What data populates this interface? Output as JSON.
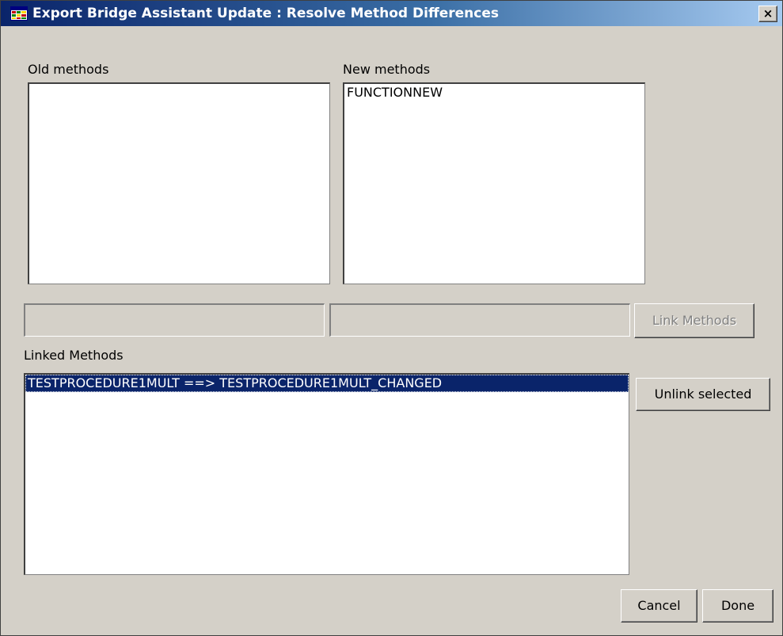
{
  "window": {
    "title": "Export Bridge Assistant Update : Resolve Method Differences",
    "close_glyph": "×"
  },
  "old_methods": {
    "label": "Old methods",
    "items": []
  },
  "new_methods": {
    "label": "New methods",
    "items": [
      "FUNCTIONNEW"
    ]
  },
  "link_fields": {
    "old_value": "",
    "new_value": ""
  },
  "buttons": {
    "link_methods": "Link Methods",
    "unlink_selected": "Unlink selected",
    "cancel": "Cancel",
    "done": "Done"
  },
  "linked_methods": {
    "label": "Linked Methods",
    "items": [
      "TESTPROCEDURE1MULT ==> TESTPROCEDURE1MULT_CHANGED"
    ],
    "selected_index": 0
  },
  "colors": {
    "selection": "#0a246a",
    "face": "#d4d0c8"
  }
}
